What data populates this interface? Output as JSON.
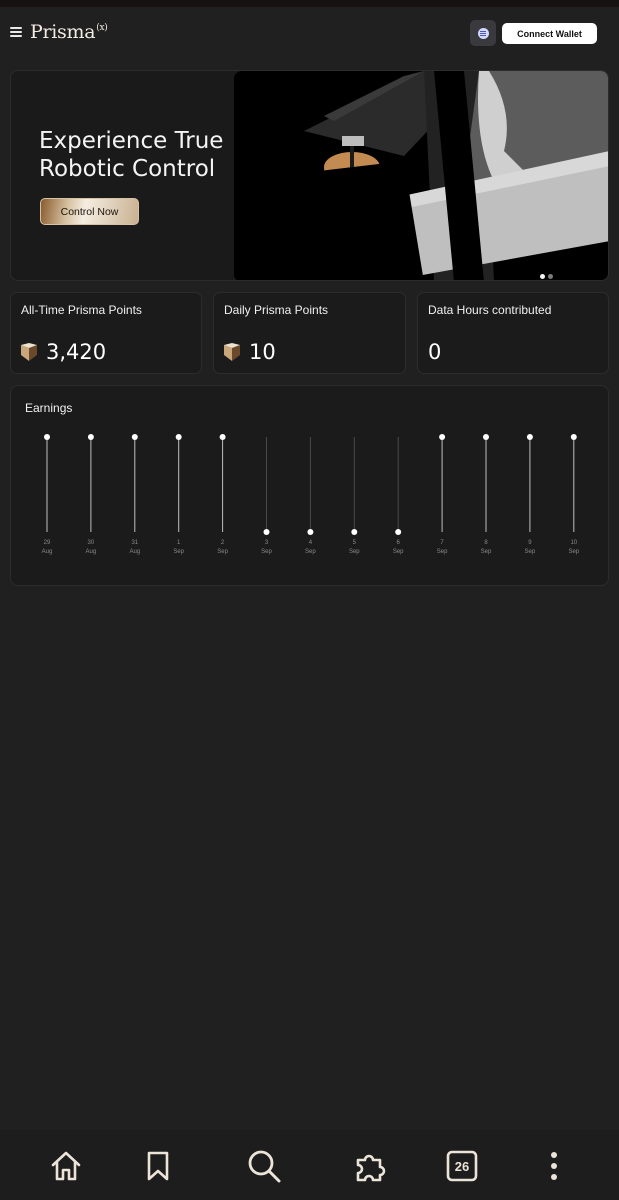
{
  "header": {
    "logo_text": "Prisma",
    "logo_suffix": "(x)",
    "connect_label": "Connect Wallet"
  },
  "hero": {
    "title": "Experience True Robotic Control",
    "cta_label": "Control Now",
    "carousel_slides": 2,
    "carousel_active": 0
  },
  "stats": [
    {
      "label": "All-Time Prisma Points",
      "value": "3,420",
      "icon": "prisma-points-icon"
    },
    {
      "label": "Daily Prisma Points",
      "value": "10",
      "icon": "prisma-points-icon"
    },
    {
      "label": "Data Hours contributed",
      "value": "0"
    }
  ],
  "earnings": {
    "title": "Earnings"
  },
  "chart_data": {
    "type": "scatter",
    "title": "Earnings",
    "categories": [
      {
        "day": "29",
        "month": "Aug"
      },
      {
        "day": "30",
        "month": "Aug"
      },
      {
        "day": "31",
        "month": "Aug"
      },
      {
        "day": "1",
        "month": "Sep"
      },
      {
        "day": "2",
        "month": "Sep"
      },
      {
        "day": "3",
        "month": "Sep"
      },
      {
        "day": "4",
        "month": "Sep"
      },
      {
        "day": "5",
        "month": "Sep"
      },
      {
        "day": "6",
        "month": "Sep"
      },
      {
        "day": "7",
        "month": "Sep"
      },
      {
        "day": "8",
        "month": "Sep"
      },
      {
        "day": "9",
        "month": "Sep"
      },
      {
        "day": "10",
        "month": "Sep"
      }
    ],
    "values": [
      1,
      1,
      1,
      1,
      1,
      0,
      0,
      0,
      0,
      1,
      1,
      1,
      1
    ],
    "ylim": [
      0,
      1
    ],
    "grid": false,
    "colors": {
      "active_stem": "#bfbfbf",
      "inactive_stem": "#4a4a4a",
      "point": "#ffffff",
      "tick": "#8a8a8a"
    }
  },
  "bottom_nav": {
    "items": [
      "home-icon",
      "bookmark-icon",
      "search-icon",
      "puzzle-icon",
      "tabs-counter-icon",
      "more-vertical-icon"
    ],
    "tab_count": "26"
  }
}
